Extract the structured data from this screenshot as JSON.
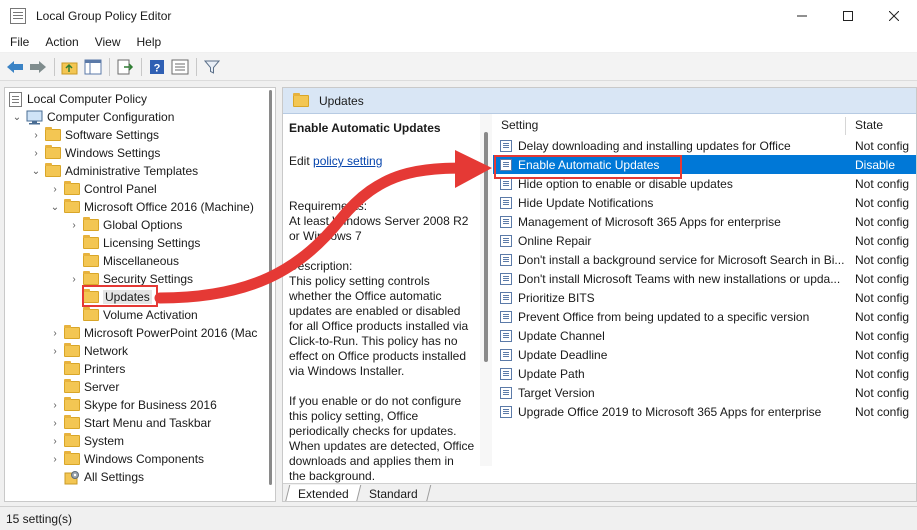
{
  "window": {
    "title": "Local Group Policy Editor"
  },
  "menu": [
    "File",
    "Action",
    "View",
    "Help"
  ],
  "tree": {
    "root": "Local Computer Policy",
    "computer_configuration": "Computer Configuration",
    "software_settings": "Software Settings",
    "windows_settings": "Windows Settings",
    "administrative_templates": "Administrative Templates",
    "control_panel": "Control Panel",
    "office_machine": "Microsoft Office 2016 (Machine)",
    "global_options": "Global Options",
    "licensing_settings": "Licensing Settings",
    "miscellaneous": "Miscellaneous",
    "security_settings": "Security Settings",
    "updates": "Updates",
    "volume_activation": "Volume Activation",
    "powerpoint": "Microsoft PowerPoint 2016 (Mac",
    "network": "Network",
    "printers": "Printers",
    "server": "Server",
    "skype": "Skype for Business 2016",
    "start_menu": "Start Menu and Taskbar",
    "system": "System",
    "windows_components": "Windows Components",
    "all_settings": "All Settings"
  },
  "details": {
    "header": "Updates",
    "title": "Enable Automatic Updates",
    "edit_prefix": "Edit",
    "edit_link": "policy setting",
    "requirements_label": "Requirements:",
    "requirements_line1": "At least Windows Server 2008 R2",
    "requirements_line2": "or Windows 7",
    "description_label": "Description:",
    "description_lines": [
      "This policy setting controls",
      "whether the Office automatic",
      "updates are enabled or disabled",
      "for all Office products installed via",
      "Click-to-Run. This policy has no",
      "effect on Office products installed",
      "via Windows Installer."
    ],
    "more_lines": [
      "If you enable or do not configure",
      "this policy setting, Office",
      "periodically checks for updates.",
      "When updates are detected, Office",
      "downloads and applies them in",
      "the background."
    ]
  },
  "columns": {
    "setting": "Setting",
    "state": "State"
  },
  "settings": [
    {
      "name": "Delay downloading and installing updates for Office",
      "state": "Not config"
    },
    {
      "name": "Enable Automatic Updates",
      "state": "Disable"
    },
    {
      "name": "Hide option to enable or disable updates",
      "state": "Not config"
    },
    {
      "name": "Hide Update Notifications",
      "state": "Not config"
    },
    {
      "name": "Management of Microsoft 365 Apps for enterprise",
      "state": "Not config"
    },
    {
      "name": "Online Repair",
      "state": "Not config"
    },
    {
      "name": "Don't install a background service for Microsoft Search in Bi...",
      "state": "Not config"
    },
    {
      "name": "Don't install Microsoft Teams with new installations or upda...",
      "state": "Not config"
    },
    {
      "name": "Prioritize BITS",
      "state": "Not config"
    },
    {
      "name": "Prevent Office from being updated to a specific version",
      "state": "Not config"
    },
    {
      "name": "Update Channel",
      "state": "Not config"
    },
    {
      "name": "Update Deadline",
      "state": "Not config"
    },
    {
      "name": "Update Path",
      "state": "Not config"
    },
    {
      "name": "Target Version",
      "state": "Not config"
    },
    {
      "name": "Upgrade Office 2019 to Microsoft 365 Apps for enterprise",
      "state": "Not config"
    }
  ],
  "selected_index": 1,
  "tabs": [
    "Extended",
    "Standard"
  ],
  "status": "15 setting(s)",
  "colors": {
    "selection": "#0078d7",
    "annotation": "#e53935",
    "header_bg": "#d9e6f5"
  }
}
